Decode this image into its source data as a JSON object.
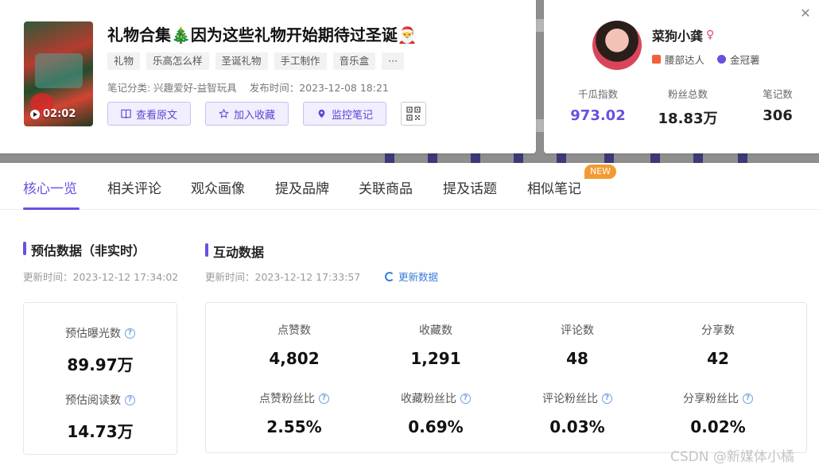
{
  "note": {
    "title": "礼物合集🎄因为这些礼物开始期待过圣诞🎅",
    "duration": "02:02",
    "tags": [
      "礼物",
      "乐高怎么样",
      "圣诞礼物",
      "手工制作",
      "音乐盒",
      "···"
    ],
    "category": "笔记分类: 兴趣爱好-益智玩具",
    "publish_time": "发布时间：2023-12-08 18:21",
    "actions": {
      "view_original": "查看原文",
      "add_favorite": "加入收藏",
      "monitor_note": "监控笔记"
    }
  },
  "author": {
    "name": "菜狗小龚",
    "gender_symbol": "♀",
    "badges": [
      "腰部达人",
      "金冠薯"
    ],
    "stats": [
      {
        "label": "千瓜指数",
        "value": "973.02"
      },
      {
        "label": "粉丝总数",
        "value": "18.83万"
      },
      {
        "label": "笔记数",
        "value": "306"
      }
    ]
  },
  "tabs": [
    "核心一览",
    "相关评论",
    "观众画像",
    "提及品牌",
    "关联商品",
    "提及话题",
    "相似笔记"
  ],
  "active_tab": "核心一览",
  "new_badge": "NEW",
  "estimate": {
    "title": "预估数据（非实时）",
    "updated": "更新时间：2023-12-12 17:34:02",
    "metrics": [
      {
        "label": "预估曝光数",
        "value": "89.97万"
      },
      {
        "label": "预估阅读数",
        "value": "14.73万"
      }
    ]
  },
  "interaction": {
    "title": "互动数据",
    "updated": "更新时间：2023-12-12 17:33:57",
    "refresh_label": "更新数据",
    "metrics": [
      {
        "label": "点赞数",
        "value": "4,802"
      },
      {
        "label": "收藏数",
        "value": "1,291"
      },
      {
        "label": "评论数",
        "value": "48"
      },
      {
        "label": "分享数",
        "value": "42"
      },
      {
        "label": "点赞粉丝比",
        "value": "2.55%"
      },
      {
        "label": "收藏粉丝比",
        "value": "0.69%"
      },
      {
        "label": "评论粉丝比",
        "value": "0.03%"
      },
      {
        "label": "分享粉丝比",
        "value": "0.02%"
      }
    ]
  },
  "watermark": "CSDN @新媒体小橘",
  "colors": {
    "accent": "#6c4fe0",
    "link": "#3b7cd6",
    "new_badge": "#f39a33"
  }
}
